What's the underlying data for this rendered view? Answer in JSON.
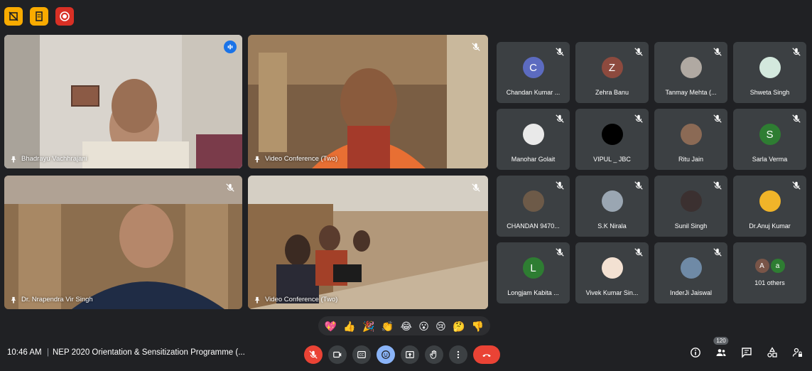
{
  "top_badges": [
    {
      "icon": "slash-square-icon",
      "color": "#f9ab00"
    },
    {
      "icon": "building-icon",
      "color": "#f9ab00"
    },
    {
      "icon": "record-icon",
      "color": "#d93025"
    }
  ],
  "main_tiles": [
    {
      "name": "Bhadrayu Vachhrajani",
      "speaking": true
    },
    {
      "name": "Video Conference (Two)",
      "speaking": false
    },
    {
      "name": "Dr. Nrapendra Vir Singh",
      "speaking": false
    },
    {
      "name": "Video Conference (Two)",
      "speaking": false
    }
  ],
  "participants": [
    {
      "name": "Chandan Kumar ...",
      "initial": "C",
      "avatar_color": "#5c6bc0"
    },
    {
      "name": "Zehra Banu",
      "initial": "Z",
      "avatar_color": "#8d4a3e"
    },
    {
      "name": "Tanmay Mehta (...",
      "initial": "",
      "avatar_color": "#b0a9a2"
    },
    {
      "name": "Shweta Singh",
      "initial": "",
      "avatar_color": "#d3e8dd"
    },
    {
      "name": "Manohar Golait",
      "initial": "",
      "avatar_color": "#e9e9e9"
    },
    {
      "name": "VIPUL _ JBC",
      "initial": "",
      "avatar_color": "#000000"
    },
    {
      "name": "Ritu Jain",
      "initial": "",
      "avatar_color": "#8b6a55"
    },
    {
      "name": "Sarla Verma",
      "initial": "S",
      "avatar_color": "#2e7d32"
    },
    {
      "name": "CHANDAN 9470...",
      "initial": "",
      "avatar_color": "#6d5a48"
    },
    {
      "name": "S.K Nirala",
      "initial": "",
      "avatar_color": "#9aa6b2"
    },
    {
      "name": "Sunil Singh",
      "initial": "",
      "avatar_color": "#3b3030"
    },
    {
      "name": "Dr.Anuj Kumar",
      "initial": "",
      "avatar_color": "#f0b429"
    },
    {
      "name": "Longjam Kabita ...",
      "initial": "L",
      "avatar_color": "#2e7d32"
    },
    {
      "name": "Vivek Kumar Sin...",
      "initial": "",
      "avatar_color": "#f3e1d2"
    },
    {
      "name": "InderJi Jaiswal",
      "initial": "",
      "avatar_color": "#6f8aa6"
    }
  ],
  "others_tile": {
    "text": "101 others",
    "initials": [
      "A",
      "a"
    ],
    "colors": [
      "#795548",
      "#2e7d32"
    ]
  },
  "reactions": [
    "💖",
    "👍",
    "🎉",
    "👏",
    "😂",
    "😮",
    "😢",
    "🤔",
    "👎"
  ],
  "bottom": {
    "time": "10:46 AM",
    "separator": "|",
    "meeting_title": "NEP 2020 Orientation & Sensitization Programme (...",
    "people_count": "120"
  },
  "controls": [
    {
      "name": "mic-off-button",
      "icon": "mic-off-icon"
    },
    {
      "name": "camera-button",
      "icon": "camera-icon"
    },
    {
      "name": "captions-button",
      "icon": "captions-icon"
    },
    {
      "name": "emoji-button",
      "icon": "emoji-icon"
    },
    {
      "name": "present-button",
      "icon": "present-icon"
    },
    {
      "name": "raise-hand-button",
      "icon": "hand-icon"
    },
    {
      "name": "more-options-button",
      "icon": "more-vert-icon"
    },
    {
      "name": "leave-call-button",
      "icon": "hangup-icon"
    }
  ],
  "colors": {
    "background": "#202124",
    "tile": "#3c4043",
    "accent_blue": "#8ab4f8",
    "danger_red": "#ea4335"
  }
}
